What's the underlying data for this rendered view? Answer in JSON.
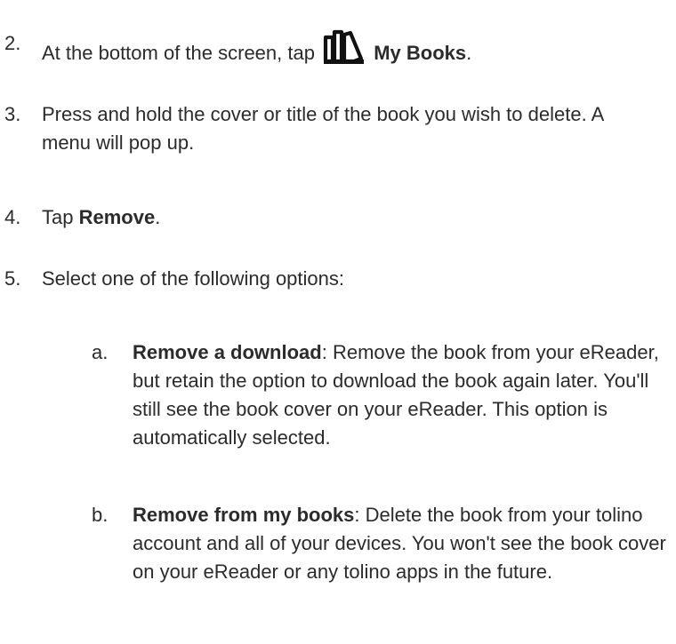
{
  "steps": [
    {
      "number": "2.",
      "before": "At the bottom of the screen, tap",
      "icon": "my-books-icon",
      "bold": "My Books",
      "after": "."
    },
    {
      "number": "3.",
      "text": "Press and hold the cover or title of the book you wish to delete. A menu will pop up."
    },
    {
      "number": "4.",
      "before": "Tap",
      "bold": "Remove",
      "after": "."
    },
    {
      "number": "5.",
      "text": "Select one of the following options:"
    }
  ],
  "options": [
    {
      "letter": "a.",
      "bold": "Remove a download",
      "text": ": Remove the book from your eReader, but retain the option to download the book again later. You'll still see the book cover on your eReader. This option is automatically selected."
    },
    {
      "letter": "b.",
      "bold": "Remove from my books",
      "text": ": Delete the book from your tolino account and all of your devices. You won't see the book cover on your eReader or any tolino apps in the future."
    }
  ]
}
